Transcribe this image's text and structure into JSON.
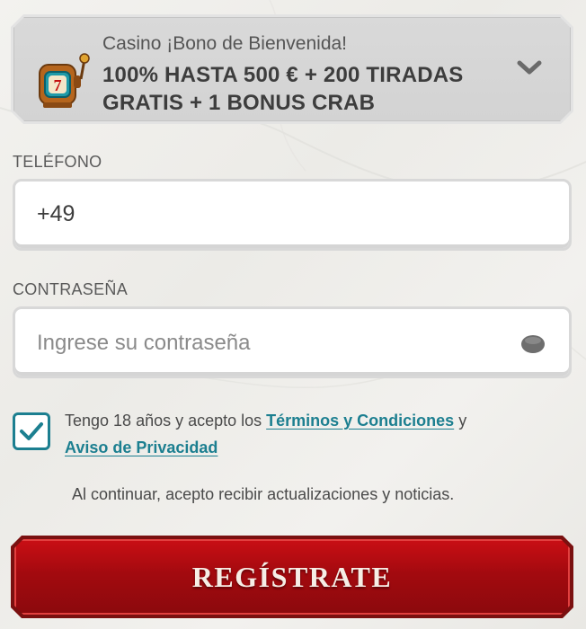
{
  "bonus": {
    "subtitle": "Casino ¡Bono de Bienvenida!",
    "title": "100% HASTA 500 € + 200 TIRADAS GRATIS + 1 BONUS CRAB",
    "icon": "slot-machine-icon"
  },
  "phone": {
    "label": "TELÉFONO",
    "value": "+49"
  },
  "password": {
    "label": "CONTRASEÑA",
    "placeholder": "Ingrese su contraseña",
    "icon": "eye-icon"
  },
  "terms": {
    "checked": true,
    "prefix": "Tengo 18 años y acepto los ",
    "terms_link": "Términos y Condiciones",
    "connector": " y",
    "privacy_link": "Aviso de Privacidad"
  },
  "notice": "Al continuar, acepto recibir actualizaciones y noticias.",
  "register_button": "REGÍSTRATE",
  "colors": {
    "accent": "#1c7f90",
    "button": "#b50c12",
    "card": "#d6d6d6"
  }
}
